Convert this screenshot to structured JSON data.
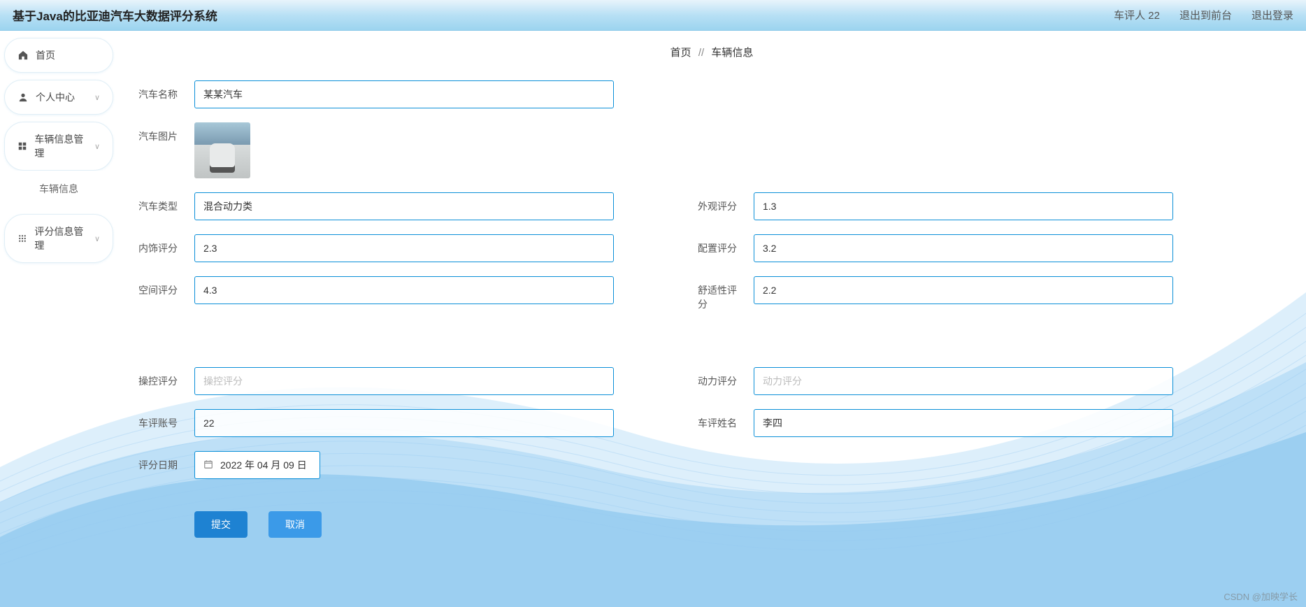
{
  "header": {
    "title": "基于Java的比亚迪汽车大数据评分系统",
    "user_label": "车评人 22",
    "logout_front": "退出到前台",
    "logout": "退出登录"
  },
  "sidebar": {
    "home": "首页",
    "personal": "个人中心",
    "vehicle_mgmt": "车辆信息管理",
    "vehicle_info": "车辆信息",
    "rating_mgmt": "评分信息管理"
  },
  "breadcrumb": {
    "home": "首页",
    "sep": "//",
    "current": "车辆信息"
  },
  "form": {
    "car_name_label": "汽车名称",
    "car_name_value": "某某汽车",
    "car_image_label": "汽车图片",
    "car_type_label": "汽车类型",
    "car_type_value": "混合动力类",
    "exterior_label": "外观评分",
    "exterior_value": "1.3",
    "interior_label": "内饰评分",
    "interior_value": "2.3",
    "config_label": "配置评分",
    "config_value": "3.2",
    "space_label": "空间评分",
    "space_value": "4.3",
    "comfort_label": "舒适性评分",
    "comfort_value": "2.2",
    "control_label": "操控评分",
    "control_placeholder": "操控评分",
    "power_label": "动力评分",
    "power_placeholder": "动力评分",
    "reviewer_account_label": "车评账号",
    "reviewer_account_value": "22",
    "reviewer_name_label": "车评姓名",
    "reviewer_name_value": "李四",
    "rating_date_label": "评分日期",
    "rating_date_value": "2022 年 04 月 09 日"
  },
  "buttons": {
    "submit": "提交",
    "cancel": "取消"
  },
  "watermark": "CSDN @加映学长"
}
